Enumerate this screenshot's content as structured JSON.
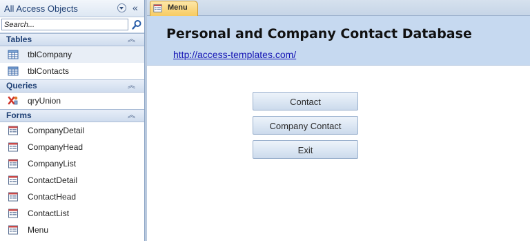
{
  "nav_pane": {
    "title": "All Access Objects",
    "search": {
      "placeholder": "Search...",
      "value": ""
    },
    "groups": [
      {
        "title": "Tables",
        "items": [
          {
            "label": "tblCompany",
            "icon": "table-icon",
            "selected": true
          },
          {
            "label": "tblContacts",
            "icon": "table-icon"
          }
        ]
      },
      {
        "title": "Queries",
        "items": [
          {
            "label": "qryUnion",
            "icon": "union-query-icon"
          }
        ]
      },
      {
        "title": "Forms",
        "items": [
          {
            "label": "CompanyDetail",
            "icon": "form-icon"
          },
          {
            "label": "CompanyHead",
            "icon": "form-icon"
          },
          {
            "label": "CompanyList",
            "icon": "form-icon"
          },
          {
            "label": "ContactDetail",
            "icon": "form-icon"
          },
          {
            "label": "ContactHead",
            "icon": "form-icon"
          },
          {
            "label": "ContactList",
            "icon": "form-icon"
          },
          {
            "label": "Menu",
            "icon": "form-icon"
          }
        ]
      }
    ]
  },
  "document": {
    "tab": {
      "label": "Menu",
      "icon": "form-icon"
    },
    "form": {
      "title": "Personal and Company Contact Database",
      "link": "http://access-templates.com/",
      "buttons": [
        "Contact",
        "Company Contact",
        "Exit"
      ]
    }
  },
  "colors": {
    "form_header": "#c6d9f0",
    "active_tab": "#f7cb62",
    "link": "#1515b4",
    "nav_group_text": "#1e3f74"
  }
}
